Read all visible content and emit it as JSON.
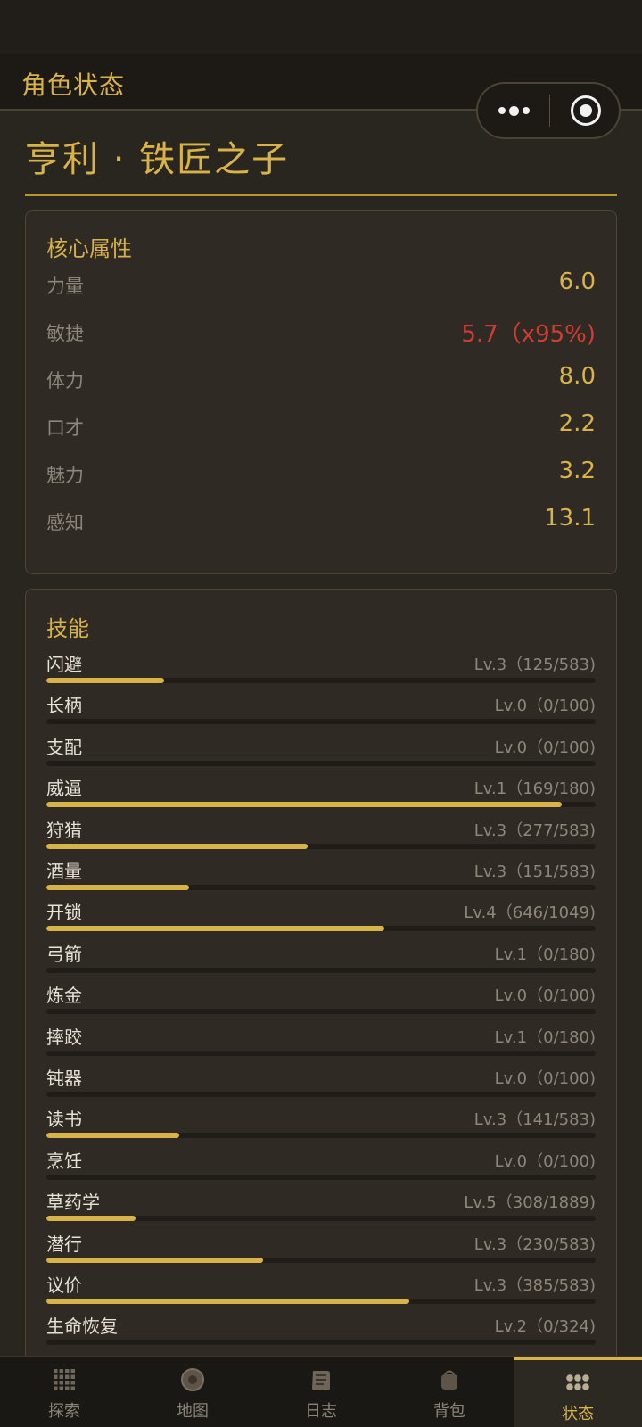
{
  "header": {
    "title": "角色状态"
  },
  "character": {
    "name": "亨利 · 铁匠之子"
  },
  "core_attributes": {
    "title": "核心属性",
    "items": [
      {
        "label": "力量",
        "value": "6.0",
        "warn": false
      },
      {
        "label": "敏捷",
        "value": "5.7（x95%)",
        "warn": true
      },
      {
        "label": "体力",
        "value": "8.0",
        "warn": false
      },
      {
        "label": "口才",
        "value": "2.2",
        "warn": false
      },
      {
        "label": "魅力",
        "value": "3.2",
        "warn": false
      },
      {
        "label": "感知",
        "value": "13.1",
        "warn": false
      }
    ]
  },
  "skills": {
    "title": "技能",
    "items": [
      {
        "label": "闪避",
        "level": "Lv.3（125/583)",
        "progress": 0.214
      },
      {
        "label": "长柄",
        "level": "Lv.0（0/100)",
        "progress": 0
      },
      {
        "label": "支配",
        "level": "Lv.0（0/100)",
        "progress": 0
      },
      {
        "label": "威逼",
        "level": "Lv.1（169/180)",
        "progress": 0.939
      },
      {
        "label": "狩猎",
        "level": "Lv.3（277/583)",
        "progress": 0.475
      },
      {
        "label": "酒量",
        "level": "Lv.3（151/583)",
        "progress": 0.259
      },
      {
        "label": "开锁",
        "level": "Lv.4（646/1049)",
        "progress": 0.616
      },
      {
        "label": "弓箭",
        "level": "Lv.1（0/180)",
        "progress": 0
      },
      {
        "label": "炼金",
        "level": "Lv.0（0/100)",
        "progress": 0
      },
      {
        "label": "摔跤",
        "level": "Lv.1（0/180)",
        "progress": 0
      },
      {
        "label": "钝器",
        "level": "Lv.0（0/100)",
        "progress": 0
      },
      {
        "label": "读书",
        "level": "Lv.3（141/583)",
        "progress": 0.242
      },
      {
        "label": "烹饪",
        "level": "Lv.0（0/100)",
        "progress": 0
      },
      {
        "label": "草药学",
        "level": "Lv.5（308/1889)",
        "progress": 0.163
      },
      {
        "label": "潜行",
        "level": "Lv.3（230/583)",
        "progress": 0.395
      },
      {
        "label": "议价",
        "level": "Lv.3（385/583)",
        "progress": 0.66
      },
      {
        "label": "生命恢复",
        "level": "Lv.2（0/324)",
        "progress": 0
      }
    ]
  },
  "tabbar": {
    "active": "状态",
    "tabs": [
      {
        "label": "探索",
        "icon": "grid-icon"
      },
      {
        "label": "地图",
        "icon": "compass-icon"
      },
      {
        "label": "日志",
        "icon": "scroll-icon"
      },
      {
        "label": "背包",
        "icon": "bag-icon"
      },
      {
        "label": "状态",
        "icon": "status-dots-icon"
      }
    ]
  },
  "colors": {
    "accent": "#d8b349",
    "warn": "#cf3d33",
    "background": "#29251f"
  }
}
